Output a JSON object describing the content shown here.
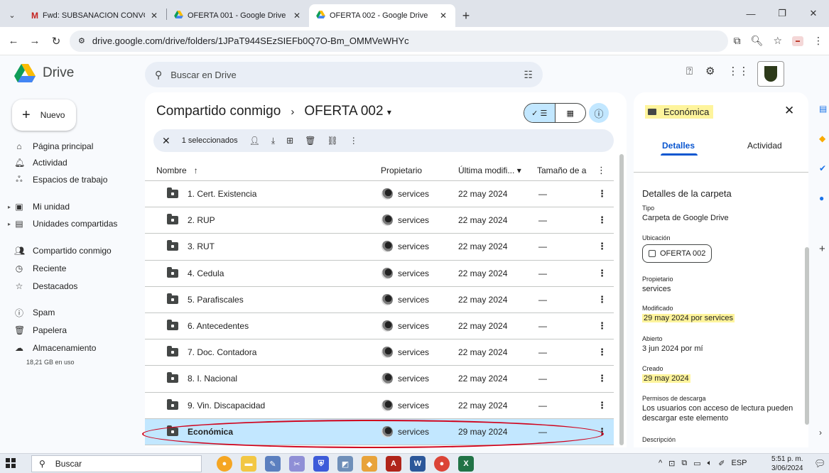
{
  "browser": {
    "tabs": [
      {
        "title": "Fwd: SUBSANACION CONVOCA",
        "favicon": "gmail-icon"
      },
      {
        "title": "OFERTA 001 - Google Drive",
        "favicon": "drive-icon"
      },
      {
        "title": "OFERTA 002 - Google Drive",
        "favicon": "drive-icon",
        "active": true
      }
    ],
    "url": "drive.google.com/drive/folders/1JPaT944SEzSIEFb0Q7O-Bm_OMMVeWHYc"
  },
  "header": {
    "app_name": "Drive",
    "search_placeholder": "Buscar en Drive"
  },
  "sidebar": {
    "new_label": "Nuevo",
    "items": [
      {
        "label": "Página principal",
        "icon": "home-icon"
      },
      {
        "label": "Actividad",
        "icon": "bell-icon"
      },
      {
        "label": "Espacios de trabajo",
        "icon": "workspaces-icon"
      },
      {
        "label": "Mi unidad",
        "icon": "my-drive-icon"
      },
      {
        "label": "Unidades compartidas",
        "icon": "shared-drives-icon"
      },
      {
        "label": "Compartido conmigo",
        "icon": "shared-with-me-icon"
      },
      {
        "label": "Reciente",
        "icon": "clock-icon"
      },
      {
        "label": "Destacados",
        "icon": "star-icon"
      },
      {
        "label": "Spam",
        "icon": "spam-icon"
      },
      {
        "label": "Papelera",
        "icon": "trash-icon"
      },
      {
        "label": "Almacenamiento",
        "icon": "cloud-icon"
      }
    ],
    "storage_used": "18,21 GB en uso"
  },
  "main": {
    "breadcrumb_root": "Compartido conmigo",
    "breadcrumb_current": "OFERTA 002",
    "selection_label": "1 seleccionados",
    "columns": {
      "name": "Nombre",
      "owner": "Propietario",
      "modified": "Última modifi...",
      "size": "Tamaño de a"
    },
    "rows": [
      {
        "name": "1. Cert. Existencia",
        "owner": "services",
        "modified": "22 may 2024",
        "size": "—"
      },
      {
        "name": "2. RUP",
        "owner": "services",
        "modified": "22 may 2024",
        "size": "—"
      },
      {
        "name": "3. RUT",
        "owner": "services",
        "modified": "22 may 2024",
        "size": "—"
      },
      {
        "name": "4. Cedula",
        "owner": "services",
        "modified": "22 may 2024",
        "size": "—"
      },
      {
        "name": "5. Parafiscales",
        "owner": "services",
        "modified": "22 may 2024",
        "size": "—"
      },
      {
        "name": "6. Antecedentes",
        "owner": "services",
        "modified": "22 may 2024",
        "size": "—"
      },
      {
        "name": "7. Doc. Contadora",
        "owner": "services",
        "modified": "22 may 2024",
        "size": "—"
      },
      {
        "name": "8. I. Nacional",
        "owner": "services",
        "modified": "22 may 2024",
        "size": "—"
      },
      {
        "name": "9. Vin. Discapacidad",
        "owner": "services",
        "modified": "22 may 2024",
        "size": "—"
      },
      {
        "name": "Económica",
        "owner": "services",
        "modified": "29 may 2024",
        "size": "—",
        "selected": true
      }
    ]
  },
  "details": {
    "title": "Económica",
    "tab_details": "Detalles",
    "tab_activity": "Actividad",
    "section_title": "Detalles de la carpeta",
    "type_label": "Tipo",
    "type_value": "Carpeta de Google Drive",
    "location_label": "Ubicación",
    "location_value": "OFERTA 002",
    "owner_label": "Propietario",
    "owner_value": "services",
    "modified_label": "Modificado",
    "modified_value": "29 may 2024 por services",
    "opened_label": "Abierto",
    "opened_value": "3 jun 2024 por mí",
    "created_label": "Creado",
    "created_value": "29 may 2024",
    "download_label": "Permisos de descarga",
    "download_value": "Los usuarios con acceso de lectura pueden descargar este elemento",
    "description_label": "Descripción"
  },
  "taskbar": {
    "search_label": "Buscar",
    "language": "ESP",
    "time": "5:51 p. m.",
    "date": "3/06/2024"
  },
  "colors": {
    "accent": "#0b57d0",
    "selected_row": "#c2e7ff",
    "highlight": "#fef49c",
    "annotation_red": "#d0021b"
  }
}
